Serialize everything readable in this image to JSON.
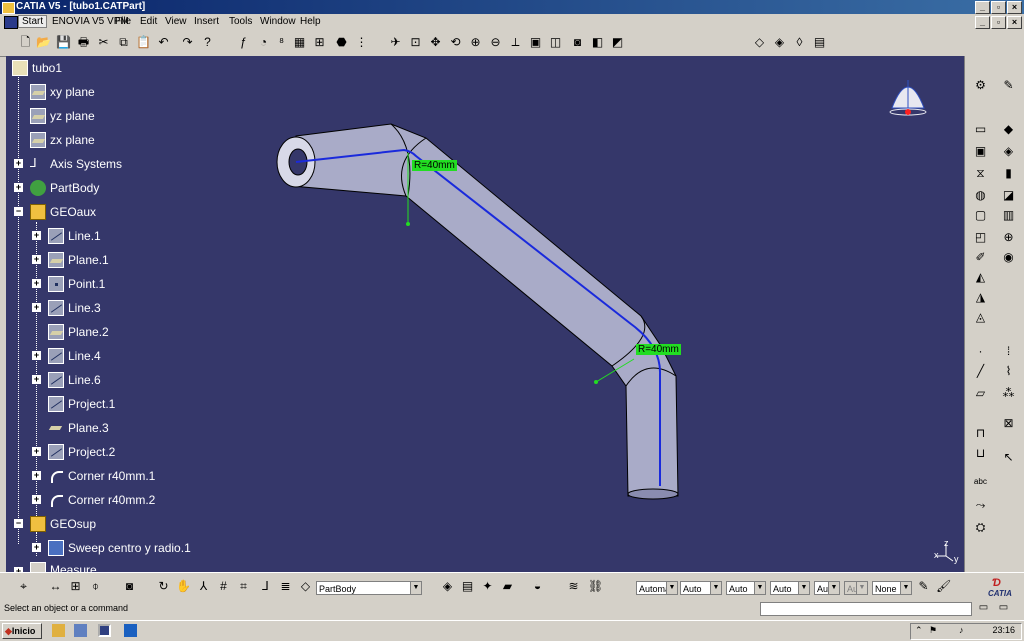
{
  "window": {
    "title": "CATIA V5 - [tubo1.CATPart]"
  },
  "menu": [
    "Start",
    "ENOVIA V5 VPM",
    "File",
    "Edit",
    "View",
    "Insert",
    "Tools",
    "Window",
    "Help"
  ],
  "tree": {
    "root": "tubo1",
    "items": [
      {
        "label": "xy plane",
        "icon": "plane-icon"
      },
      {
        "label": "yz plane",
        "icon": "plane-icon"
      },
      {
        "label": "zx plane",
        "icon": "plane-icon"
      },
      {
        "label": "Axis Systems",
        "icon": "axis-system-icon"
      },
      {
        "label": "PartBody",
        "icon": "partbody-gear-icon"
      },
      {
        "label": "GEOaux",
        "icon": "geometrical-set-icon"
      },
      {
        "label": "Line.1",
        "icon": "line-icon"
      },
      {
        "label": "Plane.1",
        "icon": "plane-icon"
      },
      {
        "label": "Point.1",
        "icon": "point-icon"
      },
      {
        "label": "Line.3",
        "icon": "line-icon"
      },
      {
        "label": "Plane.2",
        "icon": "plane-icon"
      },
      {
        "label": "Line.4",
        "icon": "line-icon"
      },
      {
        "label": "Line.6",
        "icon": "line-icon"
      },
      {
        "label": "Project.1",
        "icon": "project-icon"
      },
      {
        "label": "Plane.3",
        "icon": "plane-icon"
      },
      {
        "label": "Project.2",
        "icon": "project-icon"
      },
      {
        "label": "Corner r40mm.1",
        "icon": "corner-icon"
      },
      {
        "label": "Corner r40mm.2",
        "icon": "corner-icon"
      },
      {
        "label": "GEOsup",
        "icon": "geometrical-set-icon"
      },
      {
        "label": "Sweep centro y radio.1",
        "icon": "sweep-icon"
      },
      {
        "label": "Measure",
        "icon": "measure-icon"
      }
    ]
  },
  "annotations": {
    "radius1": "R=40mm",
    "radius2": "R=40mm"
  },
  "axis_labels": {
    "x": "x",
    "y": "y",
    "z": "z"
  },
  "bottom_toolbar": {
    "body_selector": "PartBody",
    "combos": [
      "Automa",
      "Auto",
      "Auto",
      "Auto",
      "Aut",
      "Aut",
      "None"
    ]
  },
  "status": {
    "message": "Select an object or a command"
  },
  "taskbar": {
    "start_label": "Inicio",
    "clock": "23:16"
  },
  "logo": "CATIA",
  "colors": {
    "viewport_bg": "#35376a",
    "pipe": "#a9abc8",
    "centerline": "#1a2adc",
    "annotation": "#22dd22"
  }
}
